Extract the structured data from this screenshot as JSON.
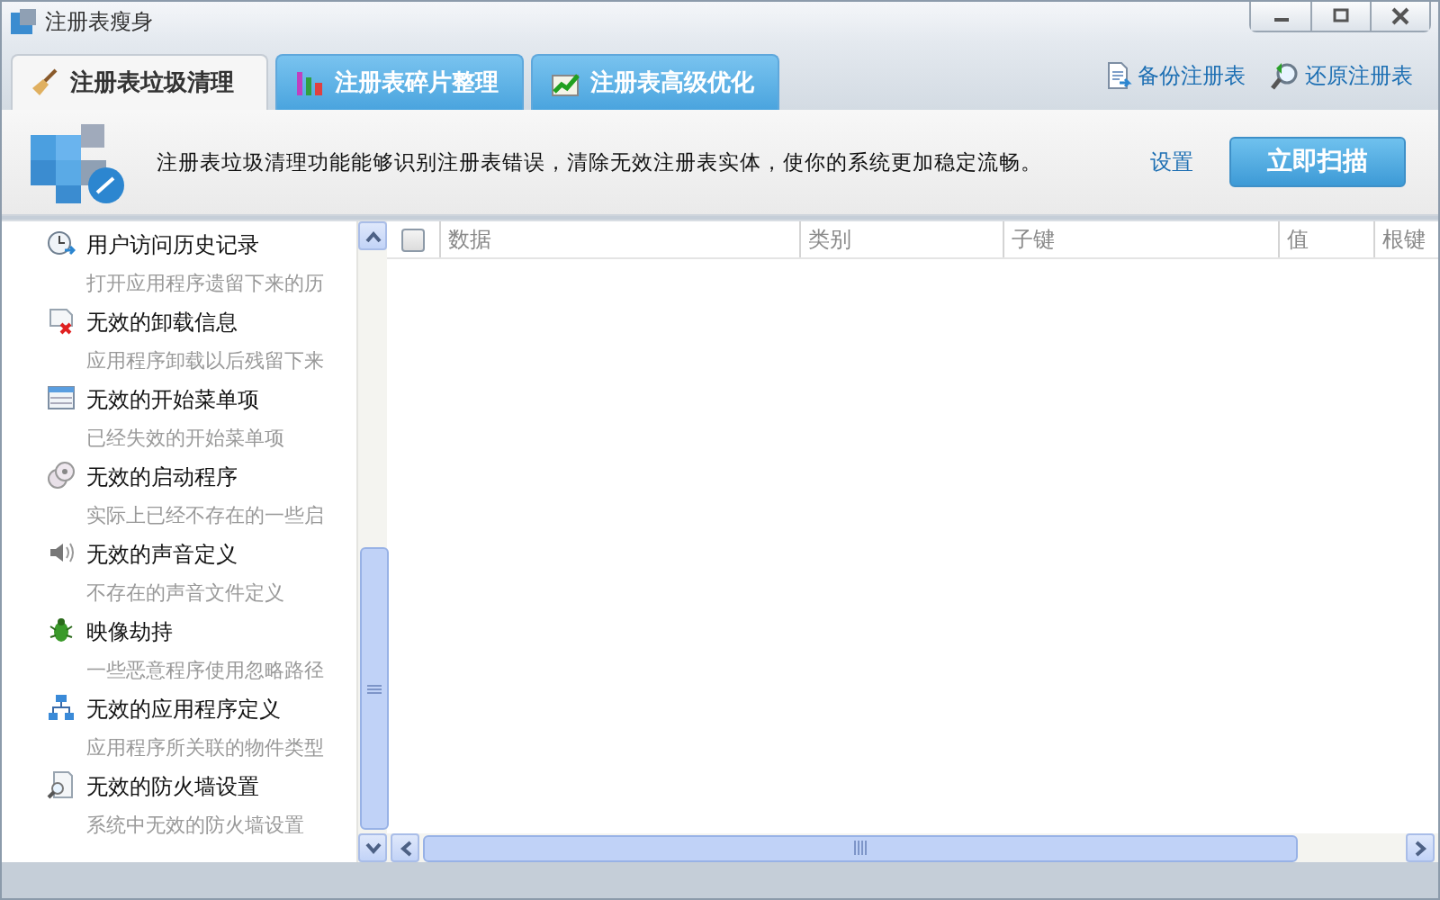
{
  "window": {
    "title": "注册表瘦身"
  },
  "tabs": [
    {
      "label": "注册表垃圾清理",
      "selected": true
    },
    {
      "label": "注册表碎片整理",
      "selected": false
    },
    {
      "label": "注册表高级优化",
      "selected": false
    }
  ],
  "top_links": [
    "备份注册表",
    "还原注册表"
  ],
  "banner": {
    "text": "注册表垃圾清理功能能够识别注册表错误，清除无效注册表实体，使你的系统更加稳定流畅。",
    "settings_link": "设置",
    "scan_button": "立即扫描"
  },
  "categories": [
    {
      "title": "用户访问历史记录",
      "desc": "打开应用程序遗留下来的历"
    },
    {
      "title": "无效的卸载信息",
      "desc": "应用程序卸载以后残留下来"
    },
    {
      "title": "无效的开始菜单项",
      "desc": "已经失效的开始菜单项"
    },
    {
      "title": "无效的启动程序",
      "desc": "实际上已经不存在的一些启"
    },
    {
      "title": "无效的声音定义",
      "desc": "不存在的声音文件定义"
    },
    {
      "title": "映像劫持",
      "desc": "一些恶意程序使用忽略路径"
    },
    {
      "title": "无效的应用程序定义",
      "desc": "应用程序所关联的物件类型"
    },
    {
      "title": "无效的防火墙设置",
      "desc": "系统中无效的防火墙设置"
    }
  ],
  "table": {
    "select_all_checked": false,
    "columns": [
      "数据",
      "类别",
      "子键",
      "值",
      "根键"
    ]
  }
}
